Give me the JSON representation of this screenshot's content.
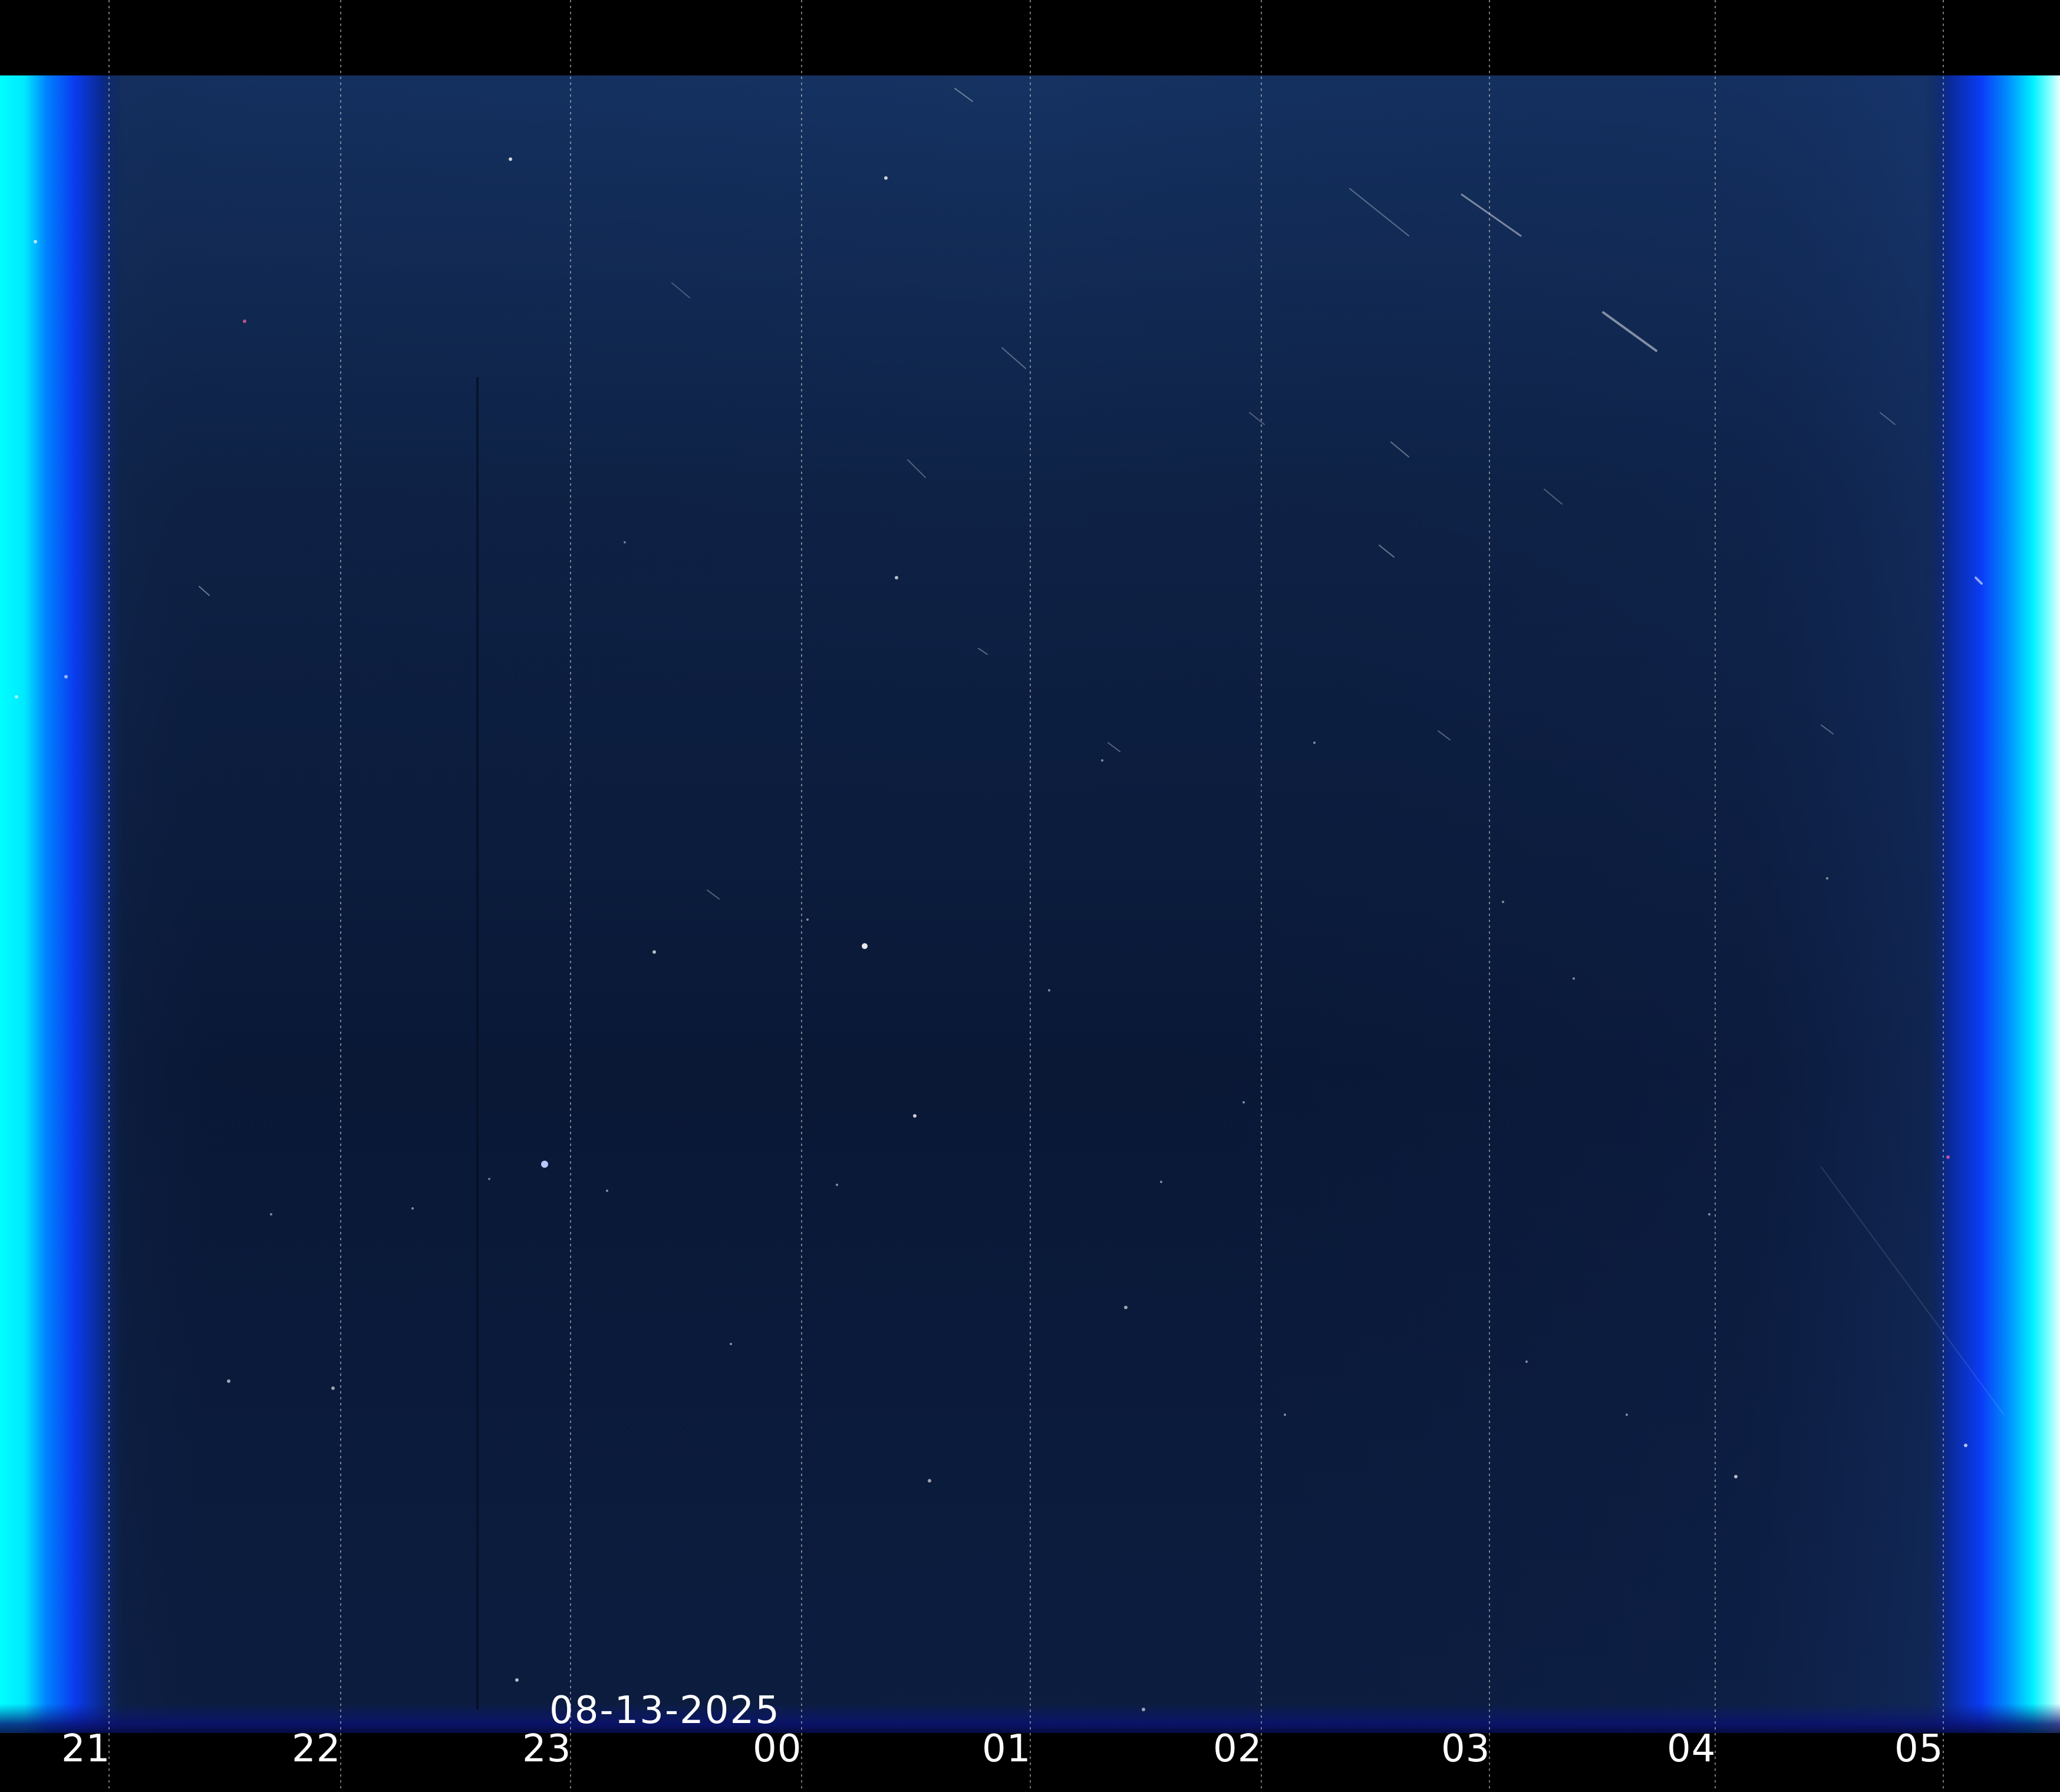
{
  "keogram": {
    "date": "08-13-2025",
    "hours": [
      "21",
      "22",
      "23",
      "00",
      "01",
      "02",
      "03",
      "04",
      "05"
    ],
    "colors": {
      "background": "#000000",
      "sky_dark": "#0a1630",
      "sky_top": "#12284e",
      "twilight_blue": "#0a3cff",
      "twilight_cyan": "#00ffff",
      "grid_line": "#bbbbbb",
      "label": "#ffffff"
    }
  }
}
